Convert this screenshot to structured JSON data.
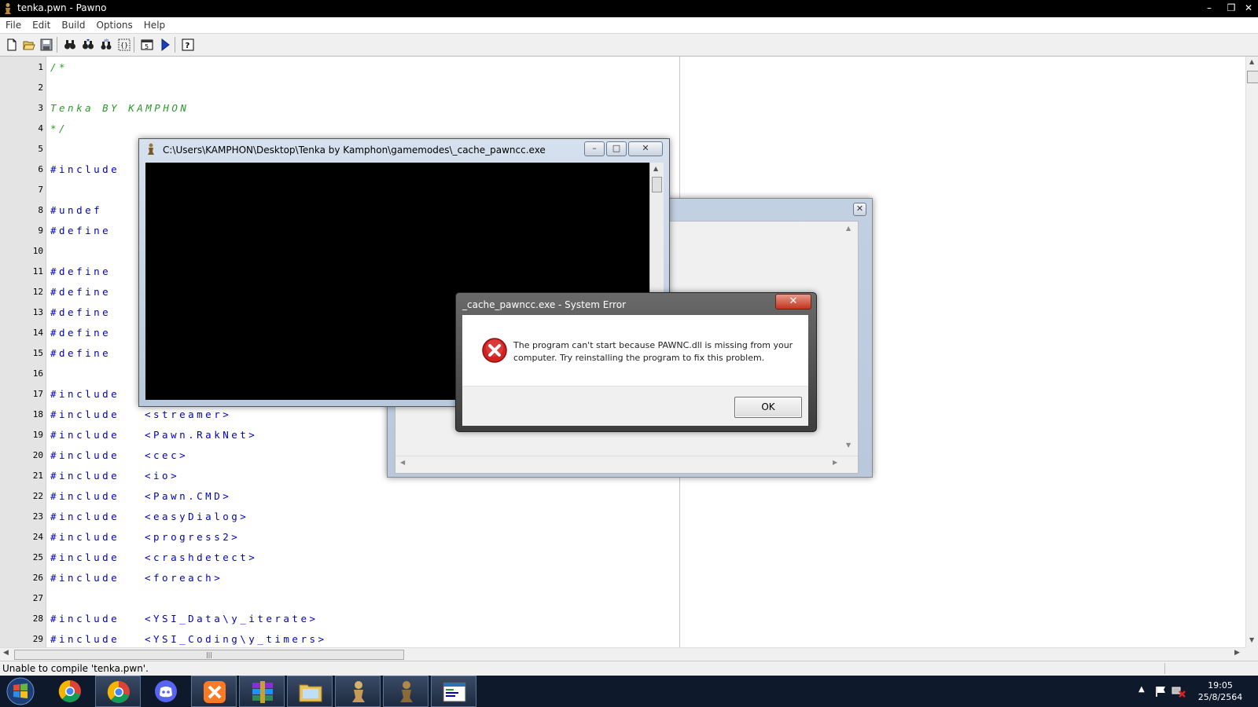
{
  "window": {
    "title": "tenka.pwn - Pawno",
    "controls": [
      "minimize-icon",
      "restore-icon",
      "close-icon"
    ]
  },
  "menu": [
    "File",
    "Edit",
    "Build",
    "Options",
    "Help"
  ],
  "toolbar": {
    "icons": [
      "new-file-icon",
      "open-folder-icon",
      "save-icon",
      "find-icon",
      "find-next-icon",
      "replace-icon",
      "goto-line-icon",
      "compile-icon",
      "run-icon",
      "help-icon"
    ]
  },
  "editor": {
    "lines": [
      {
        "n": "1",
        "kw": "",
        "cm": "/*",
        "arg": ""
      },
      {
        "n": "2",
        "kw": "",
        "cm": "",
        "arg": ""
      },
      {
        "n": "3",
        "kw": "",
        "cm": "Tenka BY KAMPHON",
        "arg": ""
      },
      {
        "n": "4",
        "kw": "",
        "cm": "*/",
        "arg": ""
      },
      {
        "n": "5",
        "kw": "",
        "cm": "",
        "arg": ""
      },
      {
        "n": "6",
        "kw": "#include",
        "cm": "",
        "arg": ""
      },
      {
        "n": "7",
        "kw": "",
        "cm": "",
        "arg": ""
      },
      {
        "n": "8",
        "kw": "#undef",
        "cm": "",
        "arg": ""
      },
      {
        "n": "9",
        "kw": "#define",
        "cm": "",
        "arg": ""
      },
      {
        "n": "10",
        "kw": "",
        "cm": "",
        "arg": ""
      },
      {
        "n": "11",
        "kw": "#define",
        "cm": "",
        "arg": ""
      },
      {
        "n": "12",
        "kw": "#define",
        "cm": "",
        "arg": ""
      },
      {
        "n": "13",
        "kw": "#define",
        "cm": "",
        "arg": ""
      },
      {
        "n": "14",
        "kw": "#define",
        "cm": "",
        "arg": ""
      },
      {
        "n": "15",
        "kw": "#define",
        "cm": "",
        "arg": ""
      },
      {
        "n": "16",
        "kw": "",
        "cm": "",
        "arg": ""
      },
      {
        "n": "17",
        "kw": "#include",
        "cm": "",
        "arg": ""
      },
      {
        "n": "18",
        "kw": "#include",
        "cm": "",
        "arg": "<streamer>"
      },
      {
        "n": "19",
        "kw": "#include",
        "cm": "",
        "arg": "<Pawn.RakNet>"
      },
      {
        "n": "20",
        "kw": "#include",
        "cm": "",
        "arg": "<cec>"
      },
      {
        "n": "21",
        "kw": "#include",
        "cm": "",
        "arg": "<io>"
      },
      {
        "n": "22",
        "kw": "#include",
        "cm": "",
        "arg": "<Pawn.CMD>"
      },
      {
        "n": "23",
        "kw": "#include",
        "cm": "",
        "arg": "<easyDialog>"
      },
      {
        "n": "24",
        "kw": "#include",
        "cm": "",
        "arg": "<progress2>"
      },
      {
        "n": "25",
        "kw": "#include",
        "cm": "",
        "arg": "<crashdetect>"
      },
      {
        "n": "26",
        "kw": "#include",
        "cm": "",
        "arg": "<foreach>"
      },
      {
        "n": "27",
        "kw": "",
        "cm": "",
        "arg": ""
      },
      {
        "n": "28",
        "kw": "#include",
        "cm": "",
        "arg": "<YSI_Data\\y_iterate>"
      },
      {
        "n": "29",
        "kw": "#include",
        "cm": "",
        "arg": "<YSI_Coding\\y_timers>"
      }
    ]
  },
  "status": {
    "message": "Unable to compile 'tenka.pwn'."
  },
  "console_window": {
    "title": "C:\\Users\\KAMPHON\\Desktop\\Tenka by Kamphon\\gamemodes\\_cache_pawncc.exe"
  },
  "error_dialog": {
    "title": "_cache_pawncc.exe - System Error",
    "message": "The program can't start because PAWNC.dll is missing from your computer. Try reinstalling the program to fix this problem.",
    "ok_label": "OK"
  },
  "taskbar": {
    "apps": [
      "chrome-icon",
      "chrome-icon",
      "discord-icon",
      "xampp-icon",
      "winrar-icon",
      "explorer-folder-icon",
      "pawno-icon",
      "pawno-icon",
      "pawno-editor-icon"
    ],
    "clock_time": "19:05",
    "clock_date": "25/8/2564"
  },
  "colors": {
    "keyword": "#0000c0",
    "comment": "#2a9a2a",
    "taskbar": "#0e1a2c"
  }
}
